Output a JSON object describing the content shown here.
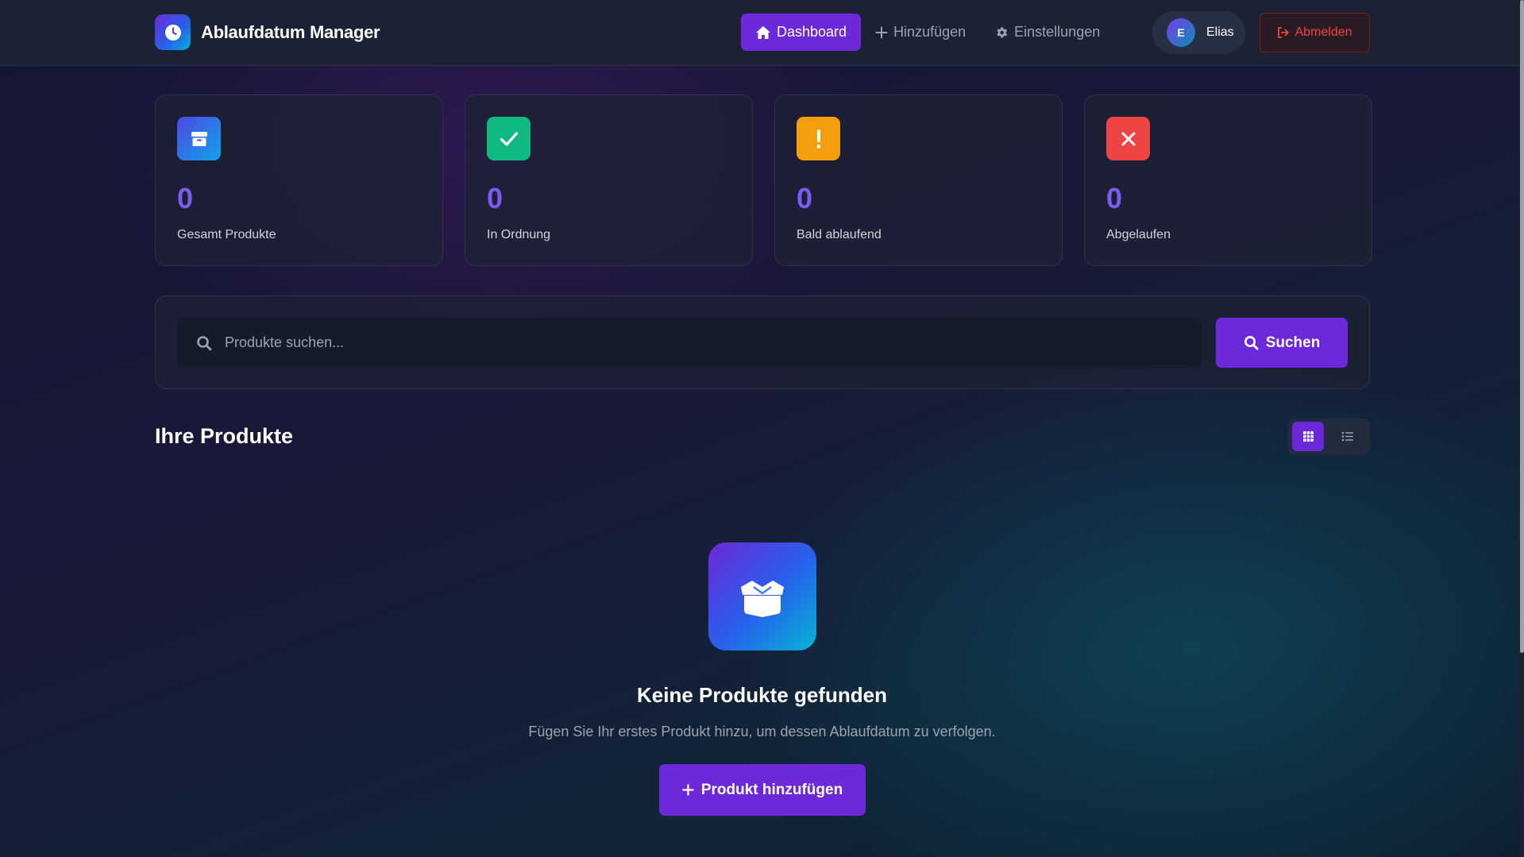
{
  "app": {
    "title": "Ablaufdatum Manager",
    "icon": "clock-icon"
  },
  "nav": {
    "items": [
      {
        "label": "Dashboard",
        "icon": "home-icon",
        "active": true
      },
      {
        "label": "Hinzufügen",
        "icon": "plus-icon",
        "active": false
      },
      {
        "label": "Einstellungen",
        "icon": "gear-icon",
        "active": false
      }
    ]
  },
  "user": {
    "initial": "E",
    "name": "Elias"
  },
  "logout": {
    "label": "Abmelden",
    "icon": "sign-out-icon"
  },
  "stats": [
    {
      "value": "0",
      "label": "Gesamt Produkte",
      "icon": "box-icon",
      "color": "#4f46e5"
    },
    {
      "value": "0",
      "label": "In Ordnung",
      "icon": "check-icon",
      "color": "#10b981"
    },
    {
      "value": "0",
      "label": "Bald ablaufend",
      "icon": "exclamation-icon",
      "color": "#f59e0b"
    },
    {
      "value": "0",
      "label": "Abgelaufen",
      "icon": "x-icon",
      "color": "#ef4444"
    }
  ],
  "search": {
    "placeholder": "Produkte suchen...",
    "value": "",
    "button_label": "Suchen"
  },
  "products": {
    "title": "Ihre Produkte",
    "view_modes": [
      "grid",
      "list"
    ],
    "active_view": "grid"
  },
  "empty_state": {
    "icon": "open-box-icon",
    "title": "Keine Produkte gefunden",
    "text": "Fügen Sie Ihr erstes Produkt hinzu, um dessen Ablaufdatum zu verfolgen.",
    "button_label": "Produkt hinzufügen"
  },
  "colors": {
    "accent": "#6d28d9",
    "stat_number": "#7c5cf0",
    "danger": "#ef4444"
  }
}
